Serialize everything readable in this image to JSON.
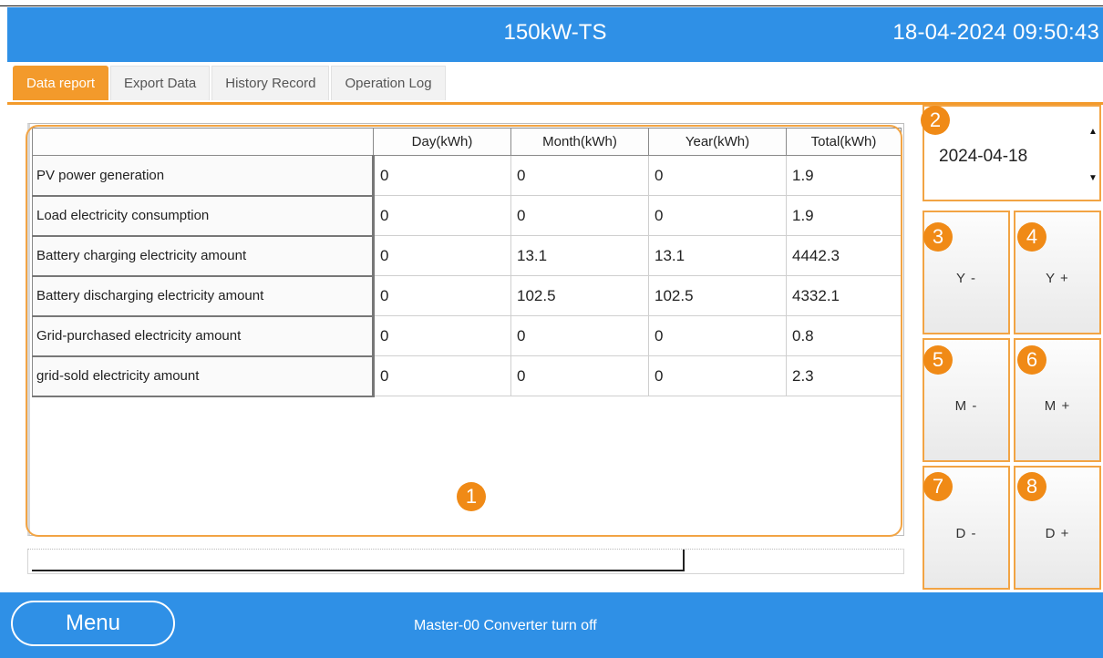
{
  "header": {
    "title": "150kW-TS",
    "clock": "18-04-2024 09:50:43"
  },
  "tabs": [
    {
      "label": "Data report",
      "active": true
    },
    {
      "label": "Export Data",
      "active": false
    },
    {
      "label": "History Record",
      "active": false
    },
    {
      "label": "Operation Log",
      "active": false
    }
  ],
  "table": {
    "columns": [
      "",
      "Day(kWh)",
      "Month(kWh)",
      "Year(kWh)",
      "Total(kWh)"
    ],
    "rows": [
      {
        "label": "PV power generation",
        "day": "0",
        "month": "0",
        "year": "0",
        "total": "1.9"
      },
      {
        "label": "Load electricity consumption",
        "day": "0",
        "month": "0",
        "year": "0",
        "total": "1.9"
      },
      {
        "label": "Battery charging electricity amount",
        "day": "0",
        "month": "13.1",
        "year": "13.1",
        "total": "4442.3"
      },
      {
        "label": "Battery discharging electricity amount",
        "day": "0",
        "month": "102.5",
        "year": "102.5",
        "total": "4332.1"
      },
      {
        "label": "Grid-purchased electricity amount",
        "day": "0",
        "month": "0",
        "year": "0",
        "total": "0.8"
      },
      {
        "label": "grid-sold electricity amount",
        "day": "0",
        "month": "0",
        "year": "0",
        "total": "2.3"
      }
    ]
  },
  "date_picker": {
    "value": "2024-04-18",
    "up_arrow": "▲",
    "down_arrow": "▼"
  },
  "buttons": {
    "year_minus": "Y -",
    "year_plus": "Y +",
    "month_minus": "M -",
    "month_plus": "M +",
    "day_minus": "D -",
    "day_plus": "D +"
  },
  "badges": {
    "b1": "1",
    "b2": "2",
    "b3": "3",
    "b4": "4",
    "b5": "5",
    "b6": "6",
    "b7": "7",
    "b8": "8"
  },
  "footer": {
    "menu_label": "Menu",
    "status": "Master-00 Converter turn off"
  },
  "colors": {
    "header_blue": "#2f90e6",
    "accent_orange": "#f39a2b",
    "badge_orange": "#f08a16"
  }
}
